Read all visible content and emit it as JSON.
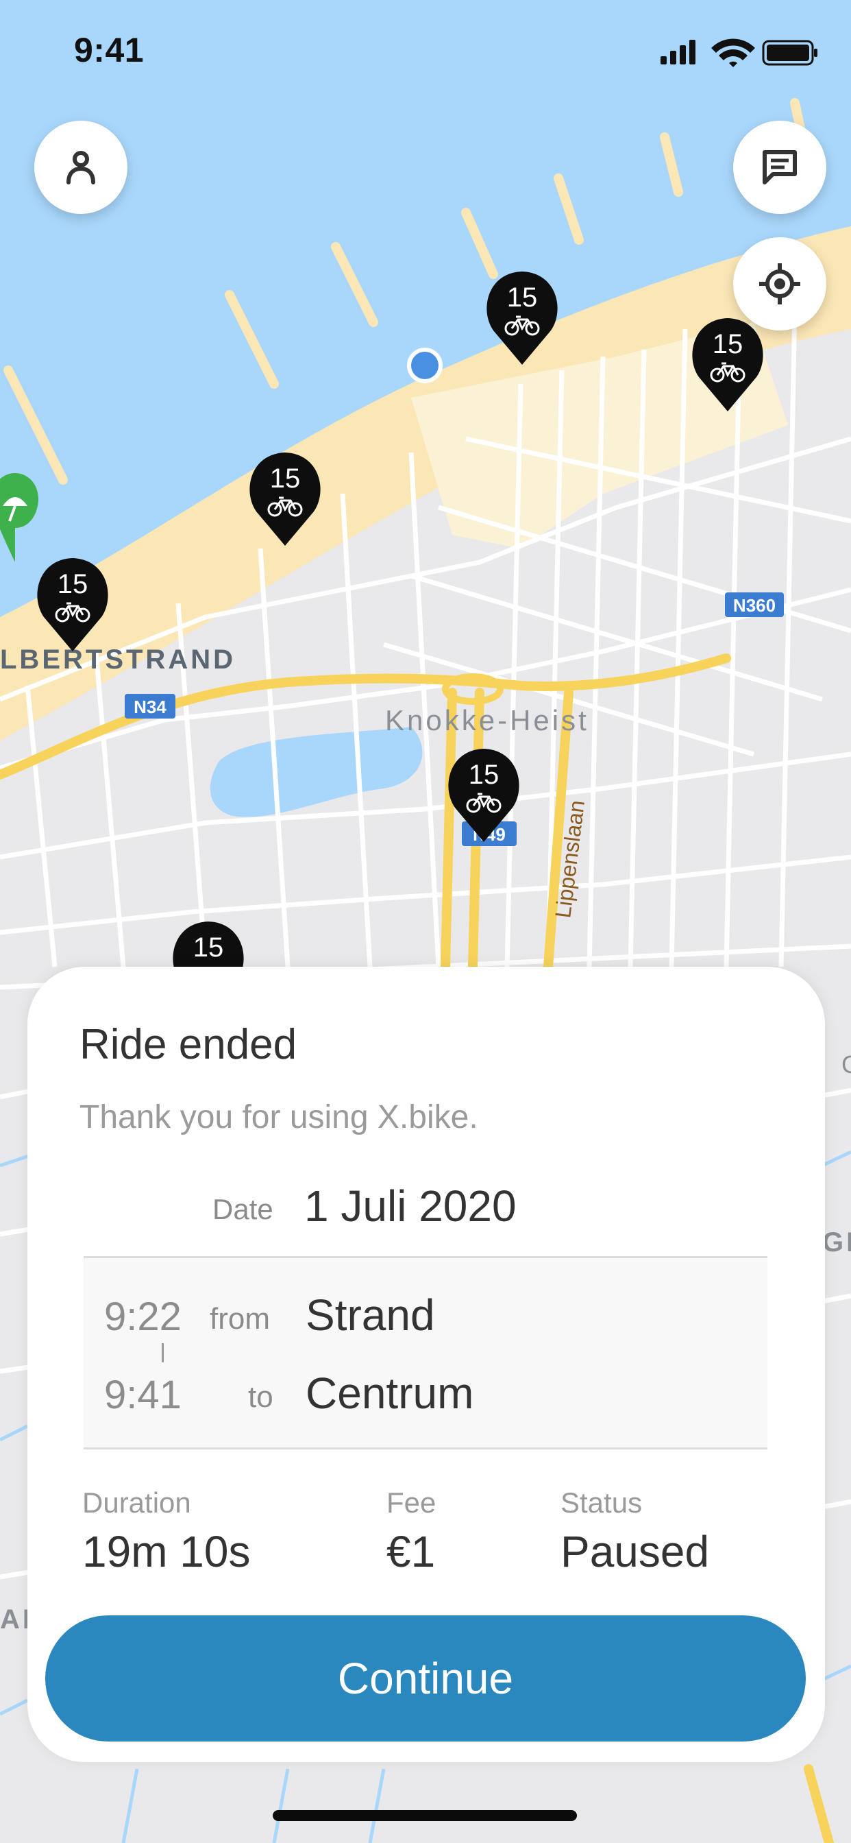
{
  "status_bar": {
    "time": "9:41"
  },
  "map": {
    "labels": {
      "district": "LBERTSTRAND",
      "city": "Knokke-Heist",
      "street": "Lippenslaan",
      "road_n34": "N34",
      "road_n360": "N360",
      "road_n49": "N49",
      "edge_g": "G",
      "edge_ge": "GE",
      "edge_a": "AF"
    },
    "bike_markers": [
      {
        "count": "15"
      },
      {
        "count": "15"
      },
      {
        "count": "15"
      },
      {
        "count": "15"
      },
      {
        "count": "15"
      },
      {
        "count": "15"
      }
    ],
    "icons": {
      "profile": "person-icon",
      "chat": "chat-icon",
      "locate": "locate-icon",
      "user_location": "user-location-dot",
      "poi": "beach-umbrella-icon"
    }
  },
  "ride_summary": {
    "title": "Ride ended",
    "subtitle": "Thank you for using X.bike.",
    "date_label": "Date",
    "date_value": "1 Juli 2020",
    "start_time": "9:22",
    "from_label": "from",
    "from_place": "Strand",
    "end_time": "9:41",
    "to_label": "to",
    "to_place": "Centrum",
    "duration_label": "Duration",
    "duration_value": "19m 10s",
    "fee_label": "Fee",
    "fee_value": "€1",
    "status_label": "Status",
    "status_value": "Paused",
    "continue_label": "Continue"
  },
  "colors": {
    "sea": "#a9d7fb",
    "beach": "#fbe7b6",
    "land": "#e9e9eb",
    "primary_button": "#2a88be",
    "marker": "#0e0e0e",
    "user_dot": "#4a90e2"
  }
}
